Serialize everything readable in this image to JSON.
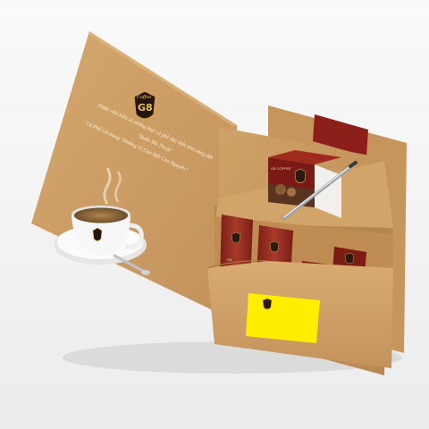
{
  "colors": {
    "background": "#f3f3f3",
    "folder": "#c99a61",
    "folder_light": "#d6aa70",
    "folder_dark": "#a97a45",
    "ribbon": "#8c1f1a",
    "card": "#ffee00",
    "cup": "#f7f7f7",
    "coffee": "#8a6438"
  },
  "brand": {
    "word": "Coffee",
    "mark": "G8"
  },
  "left_panel": {
    "lines": [
      "Được nhà hiểu là những loại cà phê đặc biệt như vàng đắt",
      "\"Buôn Ma Thuột\"",
      "Cà Phê G8 mang \"Hương Vị Của Đất Cao Nguyên\""
    ]
  },
  "items": {
    "gift_box_label": "G8 COFFEE",
    "stick_label": "G8",
    "sachet_label": "G8"
  },
  "icons": [
    "coffee-cup-icon",
    "pen-icon",
    "logo-shield-icon"
  ]
}
